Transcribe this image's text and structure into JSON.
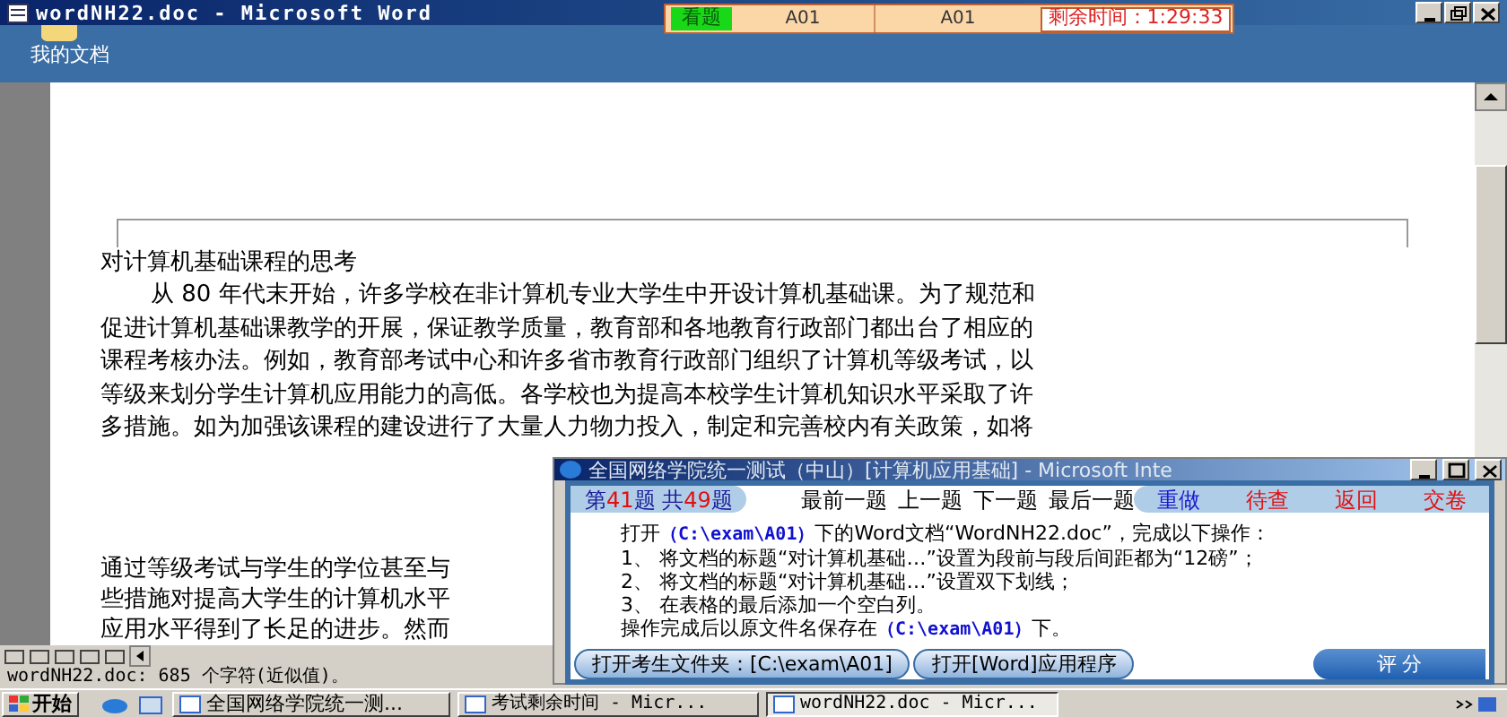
{
  "window": {
    "title": "wordNH22.doc - Microsoft Word"
  },
  "exam_bar": {
    "mode": "看题",
    "column_2": "A01",
    "column_3": "A01",
    "timer": "剩余时间：1:29:33"
  },
  "desktop_icon": {
    "label": "我的文档"
  },
  "document": {
    "title": "对计算机基础课程的思考",
    "lines": [
      "从 80 年代末开始，许多学校在非计算机专业大学生中开设计算机基础课。为了规范和",
      "促进计算机基础课教学的开展，保证教学质量，教育部和各地教育行政部门都出台了相应的",
      "课程考核办法。例如，教育部考试中心和许多省市教育行政部门组织了计算机等级考试，以",
      "等级来划分学生计算机应用能力的高低。各学校也为提高本校学生计算机知识水平采取了许",
      "多措施。如为加强该课程的建设进行了大量人力物力投入，制定和完善校内有关政策，如将"
    ],
    "lower_lines": [
      "通过等级考试与学生的学位甚至与",
      "些措施对提高大学生的计算机水平",
      "应用水平得到了长足的进步。然而"
    ]
  },
  "status_bar": "wordNH22.doc: 685 个字符(近似值)。",
  "dialog": {
    "title": "全国网络学院统一测试（中山）[计算机应用基础] - Microsoft Inte",
    "counter": [
      "第",
      "41",
      "题 共",
      "49",
      "题"
    ],
    "nav": [
      "最前一题",
      "上一题",
      "下一题",
      "最后一题"
    ],
    "actions": [
      {
        "label": "重做",
        "color": "#1a1acc"
      },
      {
        "label": "待查",
        "color": "#e01010"
      },
      {
        "label": "返回",
        "color": "#e01010"
      },
      {
        "label": "交卷",
        "color": "#e01010"
      }
    ],
    "instructions": [
      [
        {
          "text": "打开",
          "highlight": false
        },
        {
          "text": "（C:\\exam\\A01）",
          "highlight": true
        },
        {
          "text": "下的Word文档“WordNH22.doc”，完成以下操作：",
          "highlight": false
        }
      ],
      [
        {
          "text": "1、 将文档的标题“对计算机基础…”设置为段前与段后间距都为“12磅”；",
          "highlight": false
        }
      ],
      [
        {
          "text": "2、 将文档的标题“对计算机基础…”设置双下划线；",
          "highlight": false
        }
      ],
      [
        {
          "text": "3、 在表格的最后添加一个空白列。",
          "highlight": false
        }
      ],
      [
        {
          "text": "操作完成后以原文件名保存在",
          "highlight": false
        },
        {
          "text": "（C:\\exam\\A01）",
          "highlight": true
        },
        {
          "text": "下。",
          "highlight": false
        }
      ]
    ],
    "buttons": [
      "打开考生文件夹：[C:\\exam\\A01]",
      "打开[Word]应用程序"
    ],
    "score_button": "评 分"
  },
  "taskbar": {
    "start": "开始",
    "tasks": [
      {
        "label": "全国网络学院统一测...",
        "selected": false
      },
      {
        "label": "考试剩余时间 - Micr...",
        "selected": false
      },
      {
        "label": "wordNH22.doc - Micr...",
        "selected": true
      }
    ]
  }
}
